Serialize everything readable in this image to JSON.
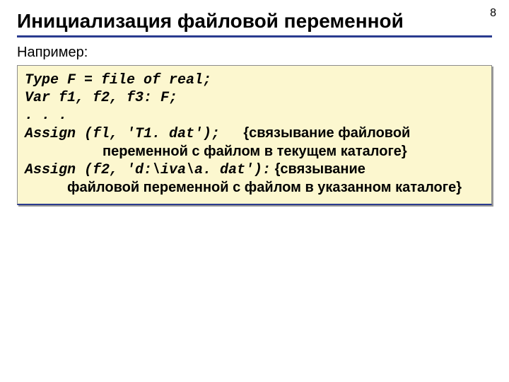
{
  "page_number": "8",
  "title": "Инициализация файловой переменной",
  "example_label": "Например:",
  "code": {
    "line1": "Type  F = file of real;",
    "line2": "Var f1, f2, f3: F;",
    "line3": ". . .",
    "line4_code": "Assign (fl, 'T1. dat');",
    "line4_comment_a": "{связывание файловой",
    "line4_comment_b": "переменной с файлом в текущем каталоге}",
    "line5_code": "Assign (f2, 'd:\\iva\\a. dat'):",
    "line5_comment_a": "{связывание",
    "line5_comment_b": "файловой переменной с файлом в указанном каталоге}"
  }
}
